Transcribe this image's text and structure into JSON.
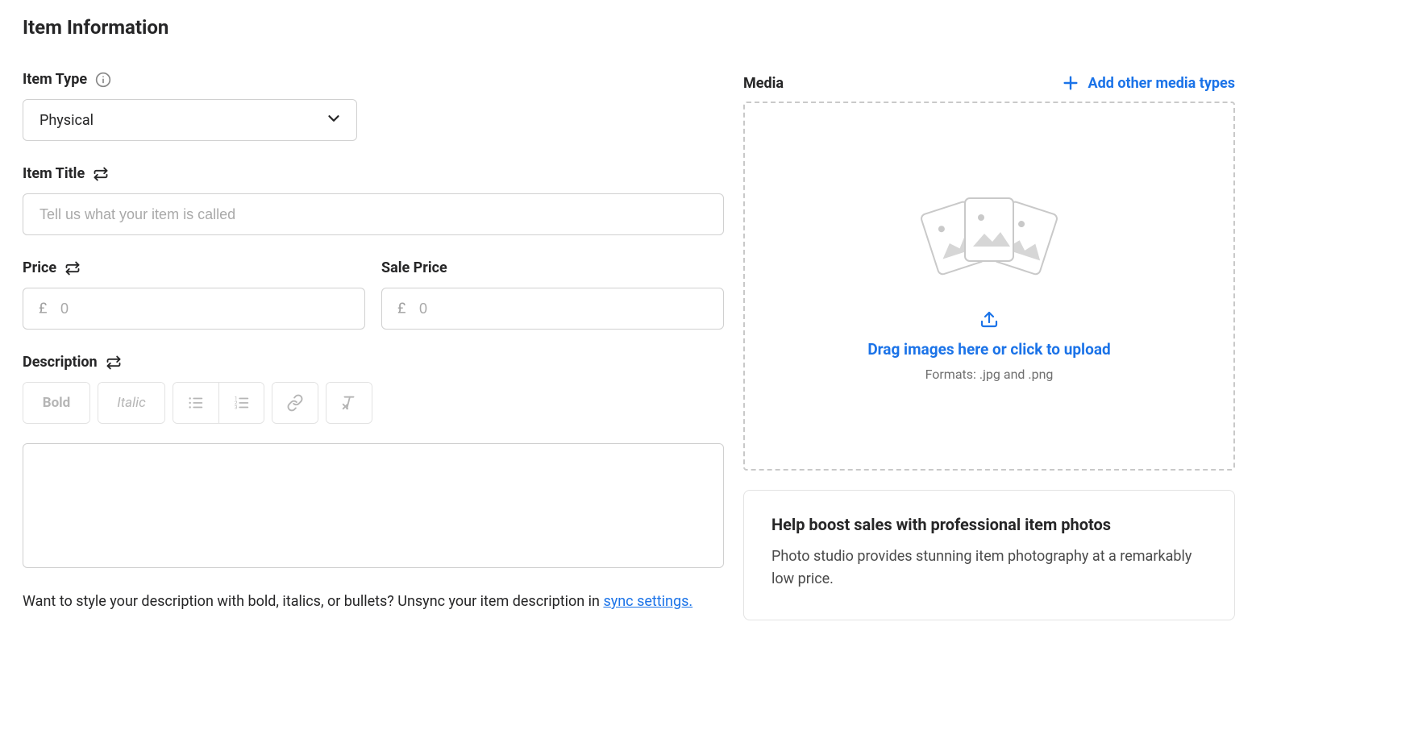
{
  "section_title": "Item Information",
  "item_type": {
    "label": "Item Type",
    "value": "Physical"
  },
  "item_title": {
    "label": "Item Title",
    "placeholder": "Tell us what your item is called",
    "value": ""
  },
  "price": {
    "label": "Price",
    "currency_symbol": "£",
    "placeholder": "0",
    "value": ""
  },
  "sale_price": {
    "label": "Sale Price",
    "currency_symbol": "£",
    "placeholder": "0",
    "value": ""
  },
  "description": {
    "label": "Description",
    "toolbar": {
      "bold": "Bold",
      "italic": "Italic"
    },
    "value": ""
  },
  "helper": {
    "prefix": "Want to style your description with bold, italics, or bullets? Unsync your item description in ",
    "link_text": "sync settings."
  },
  "media": {
    "label": "Media",
    "add_link": "Add other media types",
    "drop_text": "Drag images here or click to upload",
    "formats": "Formats: .jpg and .png"
  },
  "promo": {
    "title": "Help boost sales with professional item photos",
    "body": "Photo studio provides stunning item photography at a remarkably low price."
  }
}
